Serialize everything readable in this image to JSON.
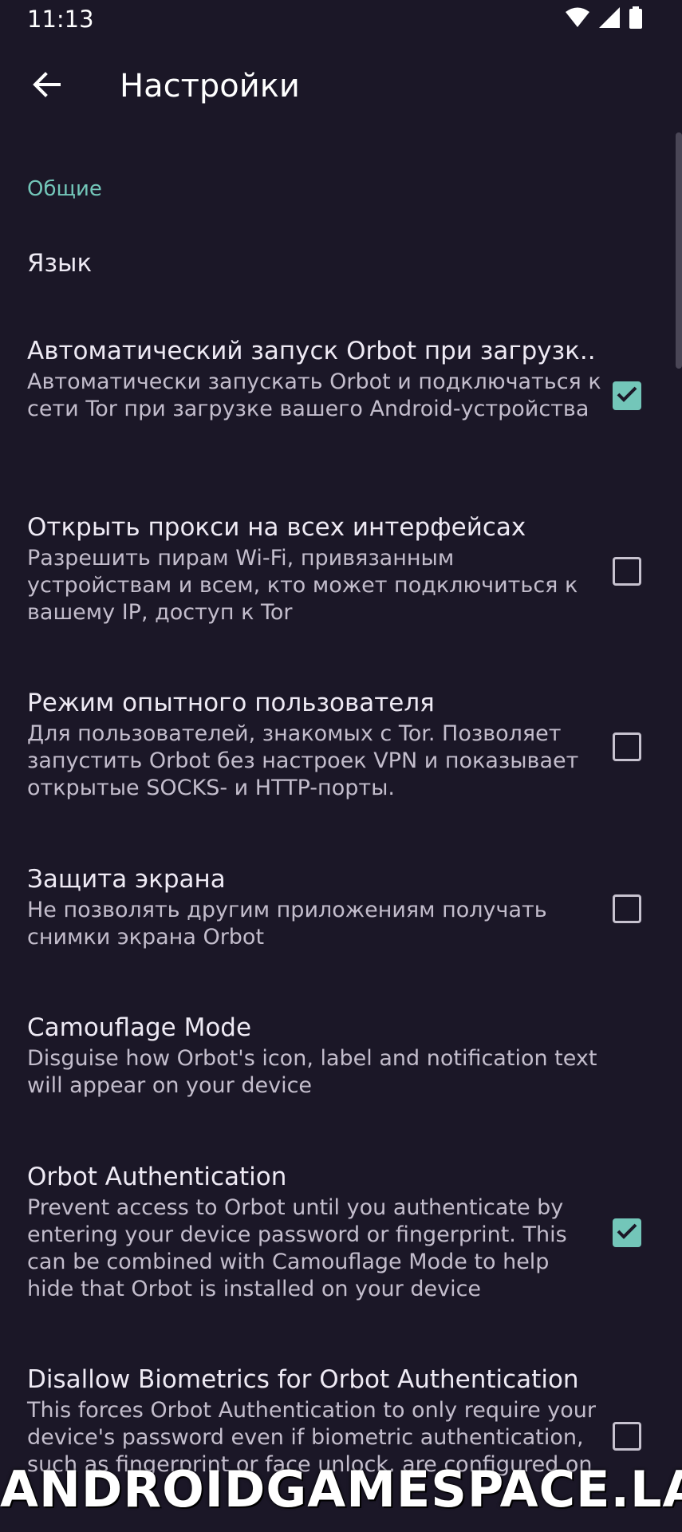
{
  "status_bar": {
    "time": "11:13",
    "icons": [
      "wifi-icon",
      "signal-icon",
      "battery-icon"
    ]
  },
  "app_bar": {
    "title": "Настройки",
    "back_icon": "arrow-back-icon"
  },
  "section": {
    "title": "Общие"
  },
  "colors": {
    "background": "#1b1727",
    "accent": "#73c6b9",
    "text": "#eeeaf4",
    "summary_text": "#c3bdcc"
  },
  "preferences": [
    {
      "title": "Язык"
    },
    {
      "title": "Автоматический запуск Orbot при загрузк..",
      "summary": "Автоматически запускать Orbot и подключаться к сети Tor при загрузке вашего Android-устройства",
      "checked": true
    },
    {
      "title": "Открыть прокси на всех интерфейсах",
      "summary": "Разрешить пирам Wi-Fi, привязанным устройствам и всем, кто может подключиться к вашему IP, доступ к Tor",
      "checked": false
    },
    {
      "title": "Режим опытного пользователя",
      "summary": "Для пользователей, знакомых с Tor. Позволяет запустить Orbot без настроек VPN и показывает открытые SOCKS- и HTTP-порты.",
      "checked": false
    },
    {
      "title": "Защита экрана",
      "summary": "Не позволять другим приложениям получать снимки экрана Orbot",
      "checked": false
    },
    {
      "title": "Camouflage Mode",
      "summary": "Disguise how Orbot's icon, label and notification text will appear on your device"
    },
    {
      "title": "Orbot Authentication",
      "summary": "Prevent access to Orbot until you authenticate by entering your device password or fingerprint. This can be combined with Camouflage Mode to help hide that Orbot is installed on your device",
      "checked": true
    },
    {
      "title": "Disallow Biometrics for Orbot Authentication",
      "summary": "This forces Orbot Authentication to only require your device's password even if biometric authentication, such as fingerprint or face unlock, are configured on",
      "checked": false
    }
  ],
  "watermark": "ANDROIDGAMESPACE.LAT"
}
